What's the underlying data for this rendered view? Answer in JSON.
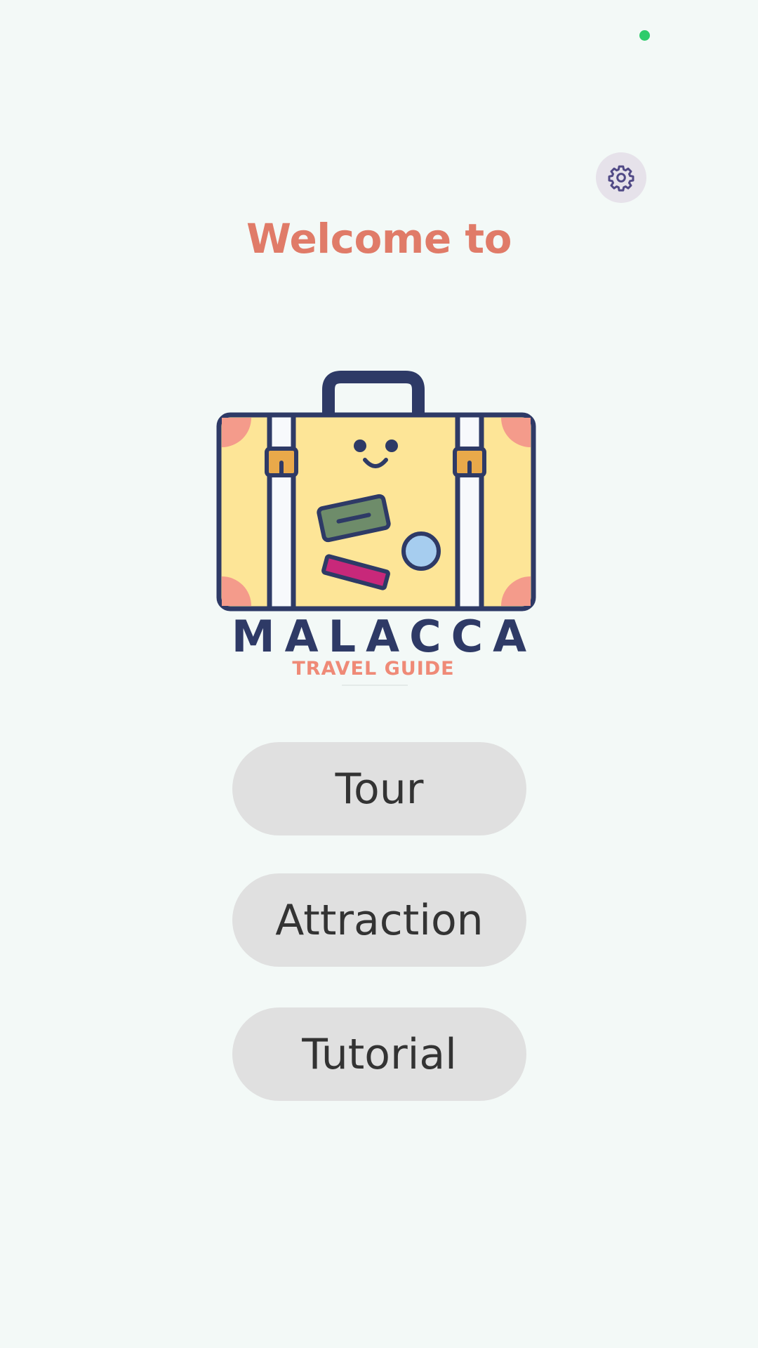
{
  "app": {
    "welcome_title": "Welcome to",
    "logo": {
      "name": "MALACCA",
      "subtitle": "TRAVEL GUIDE"
    }
  },
  "status": {
    "indicator_color": "#2ecc6b"
  },
  "settings": {
    "icon": "gear-icon"
  },
  "menu": {
    "buttons": [
      {
        "label": "Tour"
      },
      {
        "label": "Attraction"
      },
      {
        "label": "Tutorial"
      }
    ]
  },
  "colors": {
    "title": "#e07b68",
    "logo_name": "#2e3a66",
    "logo_subtitle": "#ef8a77",
    "button_bg": "#e0e0e0",
    "button_text": "#333333",
    "settings_bg": "#e6e2ea",
    "settings_icon": "#514a86",
    "background": "#f3f9f7"
  }
}
